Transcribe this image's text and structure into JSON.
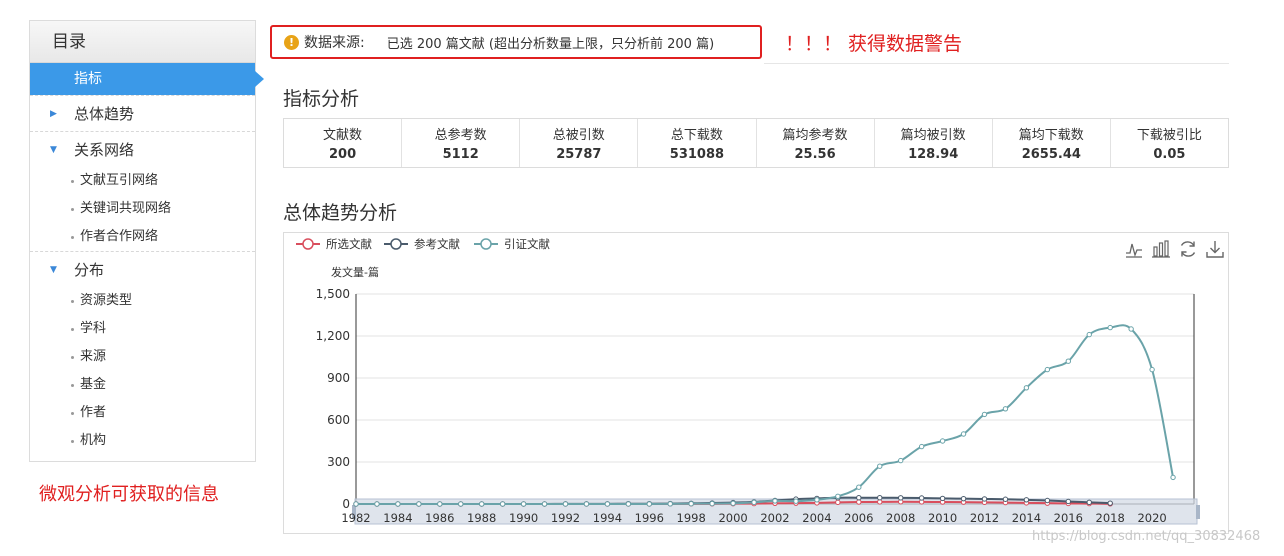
{
  "sidebar": {
    "title": "目录",
    "active_item": "指标",
    "groups": [
      {
        "label": "总体趋势",
        "expanded": false,
        "items": []
      },
      {
        "label": "关系网络",
        "expanded": true,
        "items": [
          "文献互引网络",
          "关键词共现网络",
          "作者合作网络"
        ]
      },
      {
        "label": "分布",
        "expanded": true,
        "items": [
          "资源类型",
          "学科",
          "来源",
          "基金",
          "作者",
          "机构"
        ]
      }
    ],
    "annotation": "微观分析可获取的信息"
  },
  "warning": {
    "icon": "warning-icon",
    "label": "数据来源:",
    "text": "已选 200 篇文献 (超出分析数量上限，只分析前 200 篇)",
    "annotation": "！！！ 获得数据警告"
  },
  "metrics": {
    "title": "指标分析",
    "items": [
      {
        "label": "文献数",
        "value": "200"
      },
      {
        "label": "总参考数",
        "value": "5112"
      },
      {
        "label": "总被引数",
        "value": "25787"
      },
      {
        "label": "总下载数",
        "value": "531088"
      },
      {
        "label": "篇均参考数",
        "value": "25.56"
      },
      {
        "label": "篇均被引数",
        "value": "128.94"
      },
      {
        "label": "篇均下载数",
        "value": "2655.44"
      },
      {
        "label": "下载被引比",
        "value": "0.05"
      }
    ]
  },
  "trend": {
    "title": "总体趋势分析",
    "tools": [
      "line-chart-icon",
      "bar-chart-icon",
      "refresh-icon",
      "download-icon"
    ]
  },
  "chart_data": {
    "type": "line",
    "ylabel": "发文量-篇",
    "ylim": [
      0,
      1500
    ],
    "yticks": [
      "0",
      "300",
      "600",
      "900",
      "1,200",
      "1,500"
    ],
    "x_tick_labels": [
      "1982",
      "1984",
      "1986",
      "1988",
      "1990",
      "1992",
      "1994",
      "1996",
      "1998",
      "2000",
      "2002",
      "2004",
      "2006",
      "2008",
      "2010",
      "2012",
      "2014",
      "2016",
      "2018",
      "2020"
    ],
    "x": [
      1982,
      1983,
      1984,
      1985,
      1986,
      1987,
      1988,
      1989,
      1990,
      1991,
      1992,
      1993,
      1994,
      1995,
      1996,
      1997,
      1998,
      1999,
      2000,
      2001,
      2002,
      2003,
      2004,
      2005,
      2006,
      2007,
      2008,
      2009,
      2010,
      2011,
      2012,
      2013,
      2014,
      2015,
      2016,
      2017,
      2018,
      2019,
      2020,
      2021
    ],
    "series": [
      {
        "name": "所选文献",
        "color": "#d94e5d",
        "values": [
          0,
          0,
          0,
          0,
          0,
          0,
          0,
          0,
          0,
          0,
          0,
          0,
          0,
          0,
          0,
          1,
          1,
          1,
          2,
          3,
          5,
          6,
          8,
          12,
          14,
          15,
          16,
          15,
          14,
          13,
          12,
          10,
          8,
          6,
          4,
          3,
          1,
          null,
          null,
          null
        ]
      },
      {
        "name": "参考文献",
        "color": "#4a5b6c",
        "values": [
          0,
          0,
          0,
          0,
          0,
          0,
          0,
          0,
          0,
          0,
          1,
          1,
          1,
          2,
          2,
          3,
          5,
          7,
          10,
          15,
          25,
          35,
          40,
          45,
          45,
          45,
          44,
          43,
          40,
          38,
          36,
          34,
          30,
          25,
          18,
          12,
          6,
          null,
          null,
          null
        ]
      },
      {
        "name": "引证文献",
        "color": "#6aa3a9",
        "values": [
          0,
          0,
          0,
          0,
          0,
          0,
          0,
          0,
          0,
          0,
          0,
          0,
          0,
          0,
          0,
          1,
          2,
          3,
          5,
          12,
          22,
          20,
          30,
          55,
          120,
          270,
          310,
          410,
          450,
          500,
          640,
          680,
          830,
          960,
          1020,
          1210,
          1260,
          1250,
          960,
          190
        ]
      }
    ],
    "grid": true,
    "legend": "top-left",
    "datazoom": "bottom"
  },
  "watermark": "https://blog.csdn.net/qq_30832468"
}
